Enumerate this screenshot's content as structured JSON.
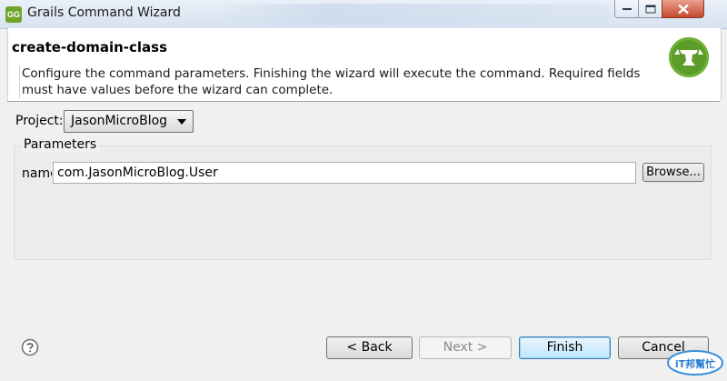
{
  "window": {
    "title": "Grails Command Wizard",
    "app_icon_text": "GG"
  },
  "header": {
    "title": "create-domain-class",
    "description": "Configure the command parameters. Finishing the wizard will execute the command. Required fields must have values before the wizard can complete.",
    "logo_icon": "grails-logo-icon"
  },
  "project": {
    "label": "Project:",
    "selected": "JasonMicroBlog"
  },
  "parameters": {
    "group_label": "Parameters",
    "name_label": "name",
    "name_value": "com.JasonMicroBlog.User",
    "browse_label": "Browse..."
  },
  "buttons": {
    "back": "< Back",
    "next": "Next >",
    "finish": "Finish",
    "cancel": "Cancel"
  },
  "watermark": {
    "text": "iT邦幫忙"
  },
  "colors": {
    "logo_green": "#5c9d2a",
    "close_red": "#c6492f",
    "finish_blue": "#3c7fb1"
  }
}
